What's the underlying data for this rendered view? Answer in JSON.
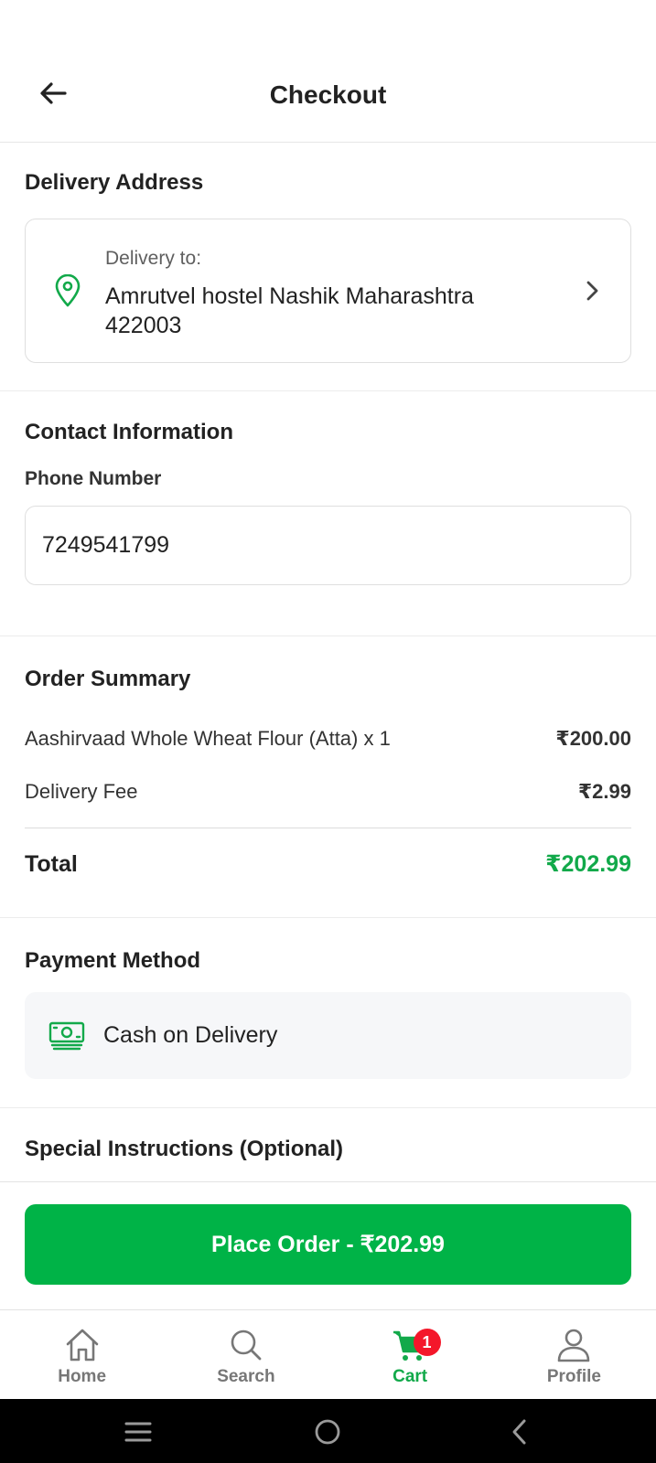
{
  "header": {
    "title": "Checkout"
  },
  "delivery": {
    "section_title": "Delivery Address",
    "label": "Delivery to:",
    "address": "Amrutvel hostel  Nashik  Maharashtra 422003"
  },
  "contact": {
    "section_title": "Contact Information",
    "phone_label": "Phone Number",
    "phone_value": "7249541799"
  },
  "order_summary": {
    "section_title": "Order Summary",
    "items": [
      {
        "label": "Aashirvaad Whole Wheat Flour (Atta) x 1",
        "value": "₹200.00"
      },
      {
        "label": "Delivery Fee",
        "value": "₹2.99"
      }
    ],
    "total_label": "Total",
    "total_value": "₹202.99",
    "accent_color": "#12a94a"
  },
  "payment": {
    "section_title": "Payment Method",
    "method": "Cash on Delivery",
    "icon": "cash-icon"
  },
  "instructions": {
    "section_title": "Special Instructions (Optional)"
  },
  "cta": {
    "label": "Place Order - ₹202.99",
    "color": "#00b347"
  },
  "nav": {
    "items": [
      {
        "label": "Home",
        "icon": "home-icon"
      },
      {
        "label": "Search",
        "icon": "search-icon"
      },
      {
        "label": "Cart",
        "icon": "cart-icon",
        "badge": "1",
        "active": true
      },
      {
        "label": "Profile",
        "icon": "profile-icon"
      }
    ]
  }
}
